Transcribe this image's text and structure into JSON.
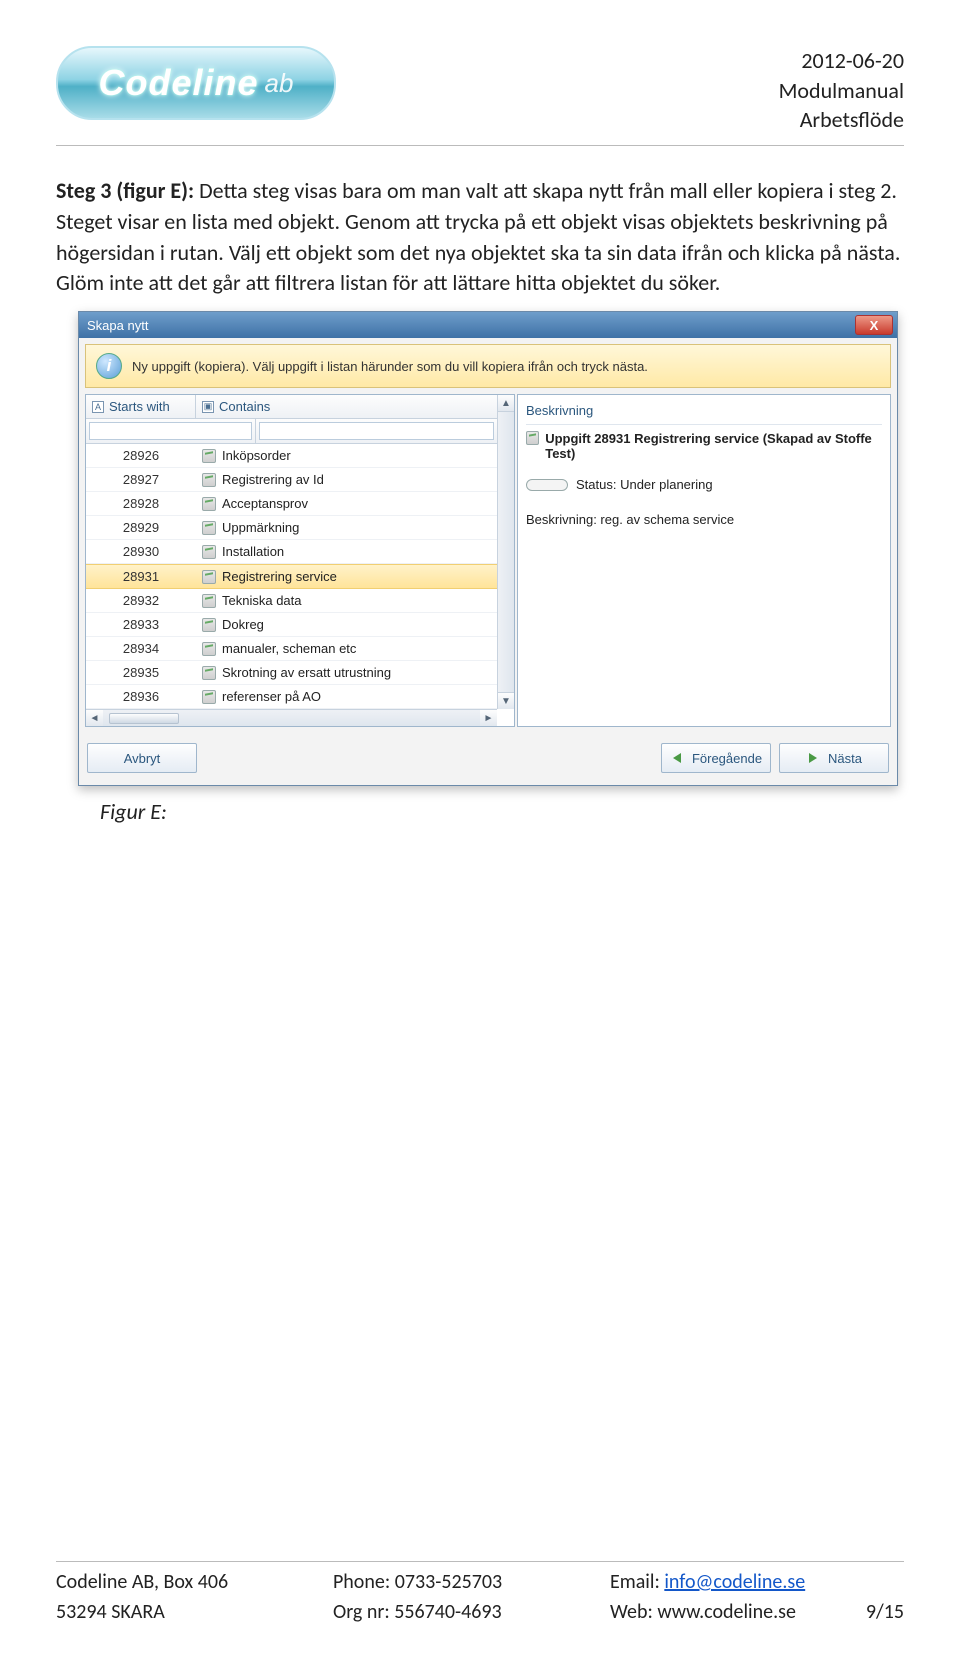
{
  "header": {
    "logo_main": "Codeline",
    "logo_sub": "ab",
    "date": "2012-06-20",
    "doc_title": "Modulmanual",
    "doc_sub": "Arbetsflöde"
  },
  "body": {
    "step_label": "Steg 3 (figur E): ",
    "paragraph": "Detta steg visas bara om man valt att skapa nytt från mall eller kopiera i steg 2. Steget visar en lista med objekt. Genom att trycka på ett objekt visas objektets beskrivning på högersidan i rutan. Välj ett objekt som det nya objektet ska ta sin data ifrån och klicka på nästa. Glöm inte att det går att filtrera listan för att lättare hitta objektet du söker.",
    "caption": "Figur E:"
  },
  "dialog": {
    "title": "Skapa nytt",
    "close": "X",
    "info_text": "Ny uppgift (kopiera). Välj uppgift i listan härunder som du vill kopiera ifrån och tryck nästa.",
    "col1": "Starts with",
    "col2": "Contains",
    "right_header": "Beskrivning",
    "right_title": "Uppgift 28931 Registrering service (Skapad av Stoffe Test)",
    "status": "Status: Under planering",
    "description": "Beskrivning: reg. av schema service",
    "rows": [
      {
        "id": "28926",
        "name": "Inköpsorder"
      },
      {
        "id": "28927",
        "name": "Registrering av Id"
      },
      {
        "id": "28928",
        "name": "Acceptansprov"
      },
      {
        "id": "28929",
        "name": "Uppmärkning"
      },
      {
        "id": "28930",
        "name": "Installation"
      },
      {
        "id": "28931",
        "name": "Registrering service",
        "selected": true
      },
      {
        "id": "28932",
        "name": "Tekniska data"
      },
      {
        "id": "28933",
        "name": "Dokreg"
      },
      {
        "id": "28934",
        "name": "manualer, scheman etc"
      },
      {
        "id": "28935",
        "name": "Skrotning av ersatt utrustning"
      },
      {
        "id": "28936",
        "name": "referenser på AO"
      }
    ],
    "btn_cancel": "Avbryt",
    "btn_prev": "Föregående",
    "btn_next": "Nästa"
  },
  "footer": {
    "company": "Codeline AB, Box 406",
    "city": "53294 SKARA",
    "phone": "Phone: 0733-525703",
    "org": "Org nr: 556740-4693",
    "email_label": "Email: ",
    "email": "info@codeline.se",
    "web": "Web: www.codeline.se",
    "page": "9/15"
  }
}
